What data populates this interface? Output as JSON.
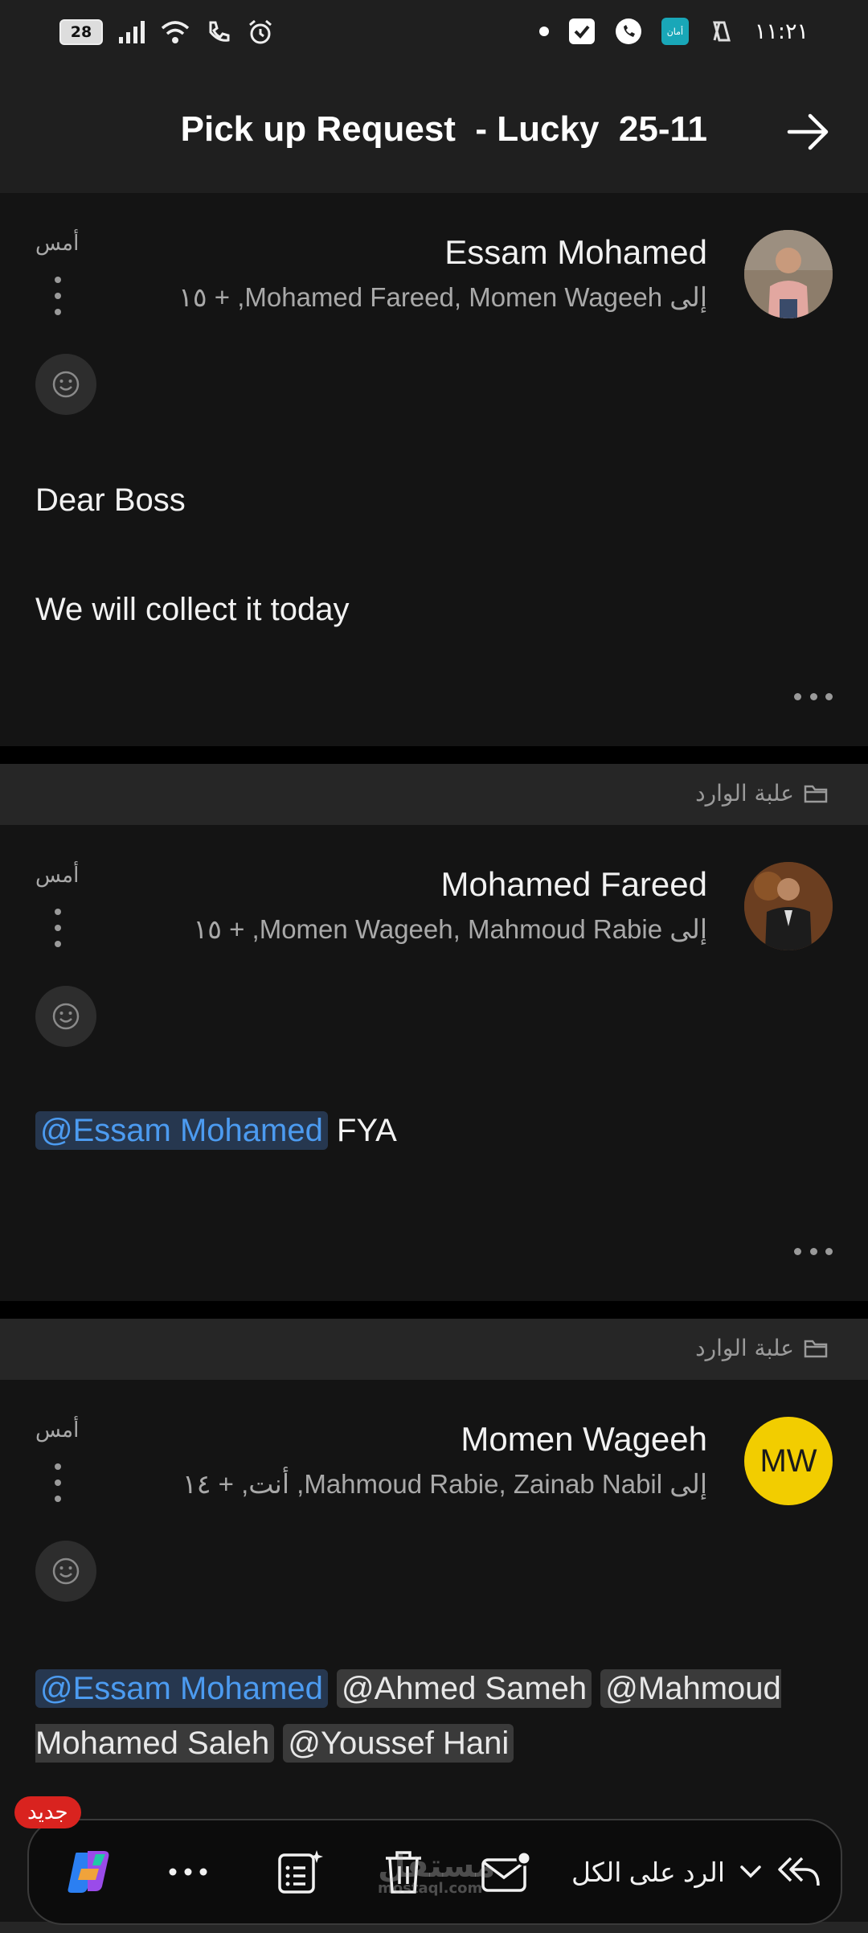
{
  "status": {
    "battery": "28",
    "time": "١١:٢١",
    "app_badge": "أمان"
  },
  "header": {
    "title": "Pick up Request  - Lucky  25-11"
  },
  "messages": [
    {
      "sender": "Essam Mohamed",
      "recipients": "إلى Mohamed Fareed, Momen Wageeh, + ١٥",
      "date": "أمس",
      "body_lines": [
        "Dear Boss",
        "We will collect it today"
      ]
    },
    {
      "folder": "علبة الوارد",
      "sender": "Mohamed Fareed",
      "recipients": "إلى Momen Wageeh, Mahmoud Rabie, + ١٥",
      "date": "أمس",
      "mention": "@Essam Mohamed",
      "body_rest": " FYA"
    },
    {
      "folder": "علبة الوارد",
      "sender": "Momen Wageeh",
      "avatar_initials": "MW",
      "recipients": "إلى Mahmoud Rabie, Zainab Nabil, أنت, + ١٤",
      "date": "أمس",
      "mentions": [
        "@Essam Mohamed",
        "@Ahmed Sameh",
        "@Mahmoud Mohamed Saleh",
        "@Youssef Hani"
      ]
    }
  ],
  "toolbar": {
    "new_badge": "جديد",
    "reply_all_label": "الرد على الكل",
    "watermark": "مستقل",
    "watermark_url": "mostaql.com"
  },
  "peek_folder": "علبة الوارد",
  "colors": {
    "accent_blue": "#4c9bf0",
    "avatar_yellow": "#f2cd00",
    "badge_red": "#d9231f"
  }
}
